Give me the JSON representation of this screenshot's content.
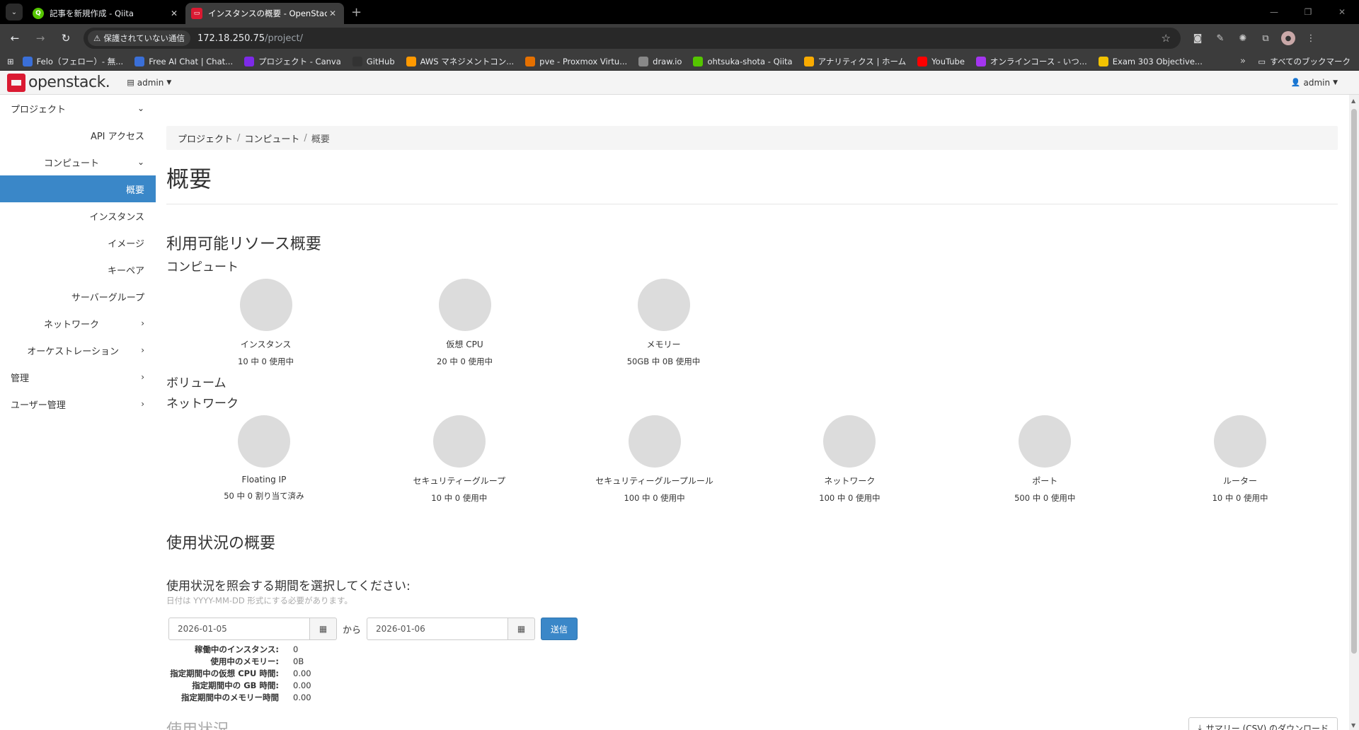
{
  "browser": {
    "tabs": [
      {
        "title": "記事を新規作成 - Qiita",
        "favicon": "qiita-icon",
        "color": "#55c500",
        "active": false
      },
      {
        "title": "インスタンスの概要 - OpenStack D",
        "favicon": "openstack-icon",
        "color": "#da1a32",
        "active": true
      }
    ],
    "security_chip": "保護されていない通信",
    "url_host": "172.18.250.75",
    "url_path": "/project/",
    "bookmarks": [
      {
        "label": "Felo（フェロー）- 無...",
        "color": "#3a6fd8"
      },
      {
        "label": "Free AI Chat | Chat...",
        "color": "#3a6fd8"
      },
      {
        "label": "プロジェクト - Canva",
        "color": "#7d2ae8"
      },
      {
        "label": "GitHub",
        "color": "#333333"
      },
      {
        "label": "AWS マネジメントコン...",
        "color": "#ff9900"
      },
      {
        "label": "pve - Proxmox Virtu...",
        "color": "#e57000"
      },
      {
        "label": "draw.io",
        "color": "#888888"
      },
      {
        "label": "ohtsuka-shota - Qiita",
        "color": "#55c500"
      },
      {
        "label": "アナリティクス | ホーム",
        "color": "#f9ab00"
      },
      {
        "label": "YouTube",
        "color": "#ff0000"
      },
      {
        "label": "オンラインコース - いつ...",
        "color": "#a435f0"
      },
      {
        "label": "Exam 303 Objective...",
        "color": "#f2c200"
      }
    ],
    "bookmarks_all": "すべてのブックマーク"
  },
  "header": {
    "logo_text": "openstack.",
    "project_label": "admin",
    "user_label": "admin"
  },
  "sidebar": {
    "project": "プロジェクト",
    "api_access": "API アクセス",
    "compute": "コンピュート",
    "overview": "概要",
    "instances": "インスタンス",
    "images": "イメージ",
    "keypairs": "キーペア",
    "server_groups": "サーバーグループ",
    "network": "ネットワーク",
    "orchestration": "オーケストレーション",
    "admin": "管理",
    "identity": "ユーザー管理"
  },
  "breadcrumb": {
    "project": "プロジェクト",
    "compute": "コンピュート",
    "current": "概要"
  },
  "page_title": "概要",
  "limits": {
    "title": "利用可能リソース概要",
    "compute_title": "コンピュート",
    "compute": [
      {
        "label": "インスタンス",
        "usage": "10 中 0 使用中"
      },
      {
        "label": "仮想 CPU",
        "usage": "20 中 0 使用中"
      },
      {
        "label": "メモリー",
        "usage": "50GB 中 0B 使用中"
      }
    ],
    "volume_title": "ボリューム",
    "network_title": "ネットワーク",
    "network": [
      {
        "label": "Floating IP",
        "usage": "50 中 0 割り当て済み"
      },
      {
        "label": "セキュリティーグループ",
        "usage": "10 中 0 使用中"
      },
      {
        "label": "セキュリティーグループルール",
        "usage": "100 中 0 使用中"
      },
      {
        "label": "ネットワーク",
        "usage": "100 中 0 使用中"
      },
      {
        "label": "ポート",
        "usage": "500 中 0 使用中"
      },
      {
        "label": "ルーター",
        "usage": "10 中 0 使用中"
      }
    ]
  },
  "usage": {
    "title": "使用状況の概要",
    "period_title": "使用状況を照会する期間を選択してください:",
    "period_help": "日付は YYYY-MM-DD 形式にする必要があります。",
    "start_date": "2026-01-05",
    "from_label": "から",
    "end_date": "2026-01-06",
    "submit": "送信",
    "stats": [
      {
        "key": "稼働中のインスタンス:",
        "value": "0"
      },
      {
        "key": "使用中のメモリー:",
        "value": "0B"
      },
      {
        "key": "指定期間中の仮想 CPU 時間:",
        "value": "0.00"
      },
      {
        "key": "指定期間中の GB 時間:",
        "value": "0.00"
      },
      {
        "key": "指定期間中のメモリー時間",
        "value": "0.00"
      }
    ],
    "usage_sub": "使用状況",
    "csv_button": "サマリー (CSV) のダウンロード"
  }
}
